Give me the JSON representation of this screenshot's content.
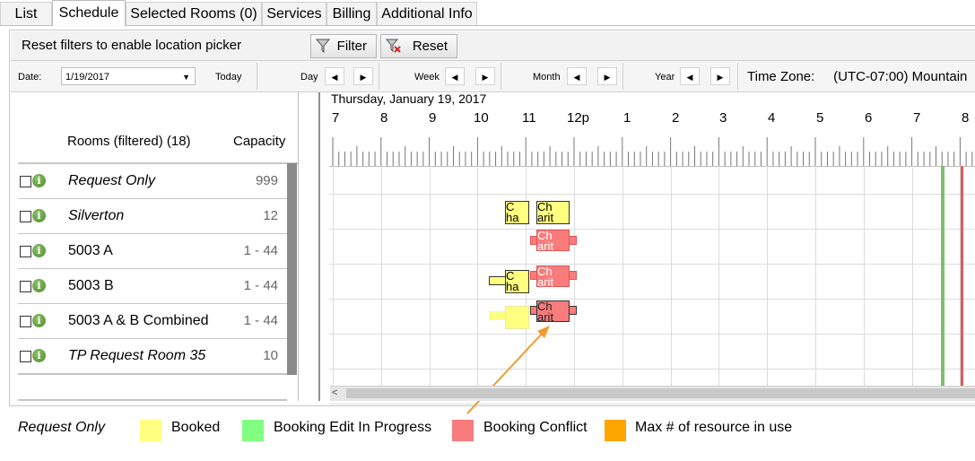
{
  "tabs": [
    "List",
    "Schedule",
    "Selected Rooms (0)",
    "Services",
    "Billing",
    "Additional Info"
  ],
  "filterbar": {
    "message": "Reset filters to enable location picker",
    "filter_label": "Filter",
    "reset_label": "Reset"
  },
  "navbar": {
    "date_label": "Date:",
    "date_value": "1/19/2017",
    "today_label": "Today",
    "day_label": "Day",
    "week_label": "Week",
    "month_label": "Month",
    "year_label": "Year",
    "timezone_label": "Time Zone:",
    "timezone_value": "(UTC-07:00) Mountain"
  },
  "rooms": {
    "header_rooms": "Rooms (filtered) (18)",
    "header_capacity": "Capacity",
    "items": [
      {
        "name": "Request Only",
        "capacity": "999",
        "italic": true
      },
      {
        "name": "Silverton",
        "capacity": "12",
        "italic": true
      },
      {
        "name": "5003 A",
        "capacity": "1 - 44",
        "italic": false
      },
      {
        "name": "5003 B",
        "capacity": "1 - 44",
        "italic": false
      },
      {
        "name": "5003 A & B Combined",
        "capacity": "1 - 44",
        "italic": false
      },
      {
        "name": "TP Request Room 35",
        "capacity": "10",
        "italic": true
      }
    ]
  },
  "schedule": {
    "title": "Thursday, January 19, 2017",
    "hours": [
      "7",
      "8",
      "9",
      "10",
      "11",
      "12p",
      "1",
      "2",
      "3",
      "4",
      "5",
      "6",
      "7",
      "8"
    ],
    "booking_labels": {
      "cha": "C ha",
      "charit": "Ch arit"
    }
  },
  "legend": {
    "request_only": "Request Only",
    "booked": "Booked",
    "edit_in_progress": "Booking Edit In Progress",
    "conflict": "Booking Conflict",
    "max_resource": "Max # of resource in use",
    "colors": {
      "booked": "#ffff80",
      "edit": "#80ff80",
      "conflict": "#f87c7c",
      "max": "#ffa500"
    }
  }
}
